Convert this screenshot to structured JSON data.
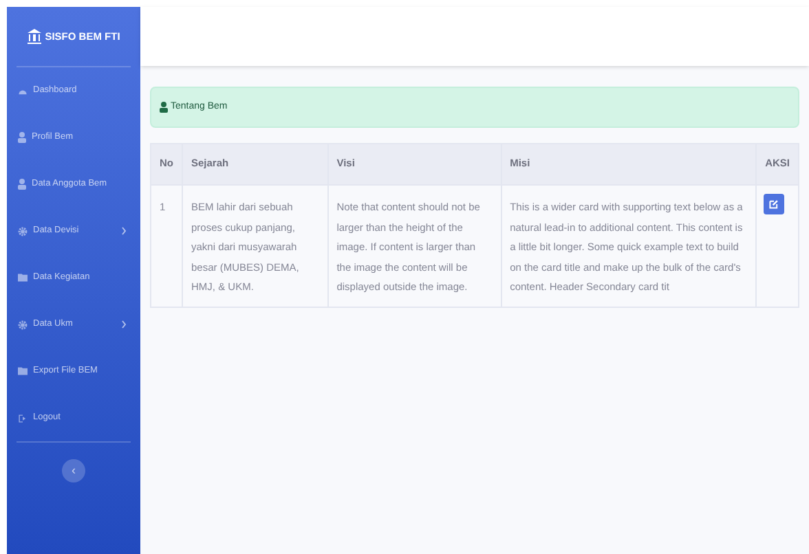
{
  "sidebar": {
    "brand": "SISFO BEM FTI",
    "items": [
      {
        "label": "Dashboard",
        "kind": "gauge",
        "has_children": false
      },
      {
        "label": "Profil Bem",
        "kind": "user",
        "has_children": false
      },
      {
        "label": "Data Anggota Bem",
        "kind": "user",
        "has_children": false
      },
      {
        "label": "Data Devisi",
        "kind": "cog",
        "has_children": true
      },
      {
        "label": "Data Kegiatan",
        "kind": "folder",
        "has_children": false
      },
      {
        "label": "Data Ukm",
        "kind": "cog",
        "has_children": true
      },
      {
        "label": "Export File BEM",
        "kind": "folder",
        "has_children": false
      },
      {
        "label": "Logout",
        "kind": "logout",
        "has_children": false
      }
    ],
    "toggle": "‹"
  },
  "alert": {
    "text": "Tentang Bem"
  },
  "table": {
    "columns": [
      "No",
      "Sejarah",
      "Visi",
      "Misi",
      "AKSI"
    ],
    "rows": [
      {
        "no": "1",
        "sejarah": "BEM lahir dari sebuah proses cukup panjang, yakni dari musyawarah besar (MUBES) DEMA, HMJ, & UKM.",
        "visi": "Note that content should not be larger than the height of the image. If content is larger than the image the content will be displayed outside the image.",
        "misi": "This is a wider card with supporting text below as a natural lead-in to additional content. This content is a little bit longer. Some quick example text to build on the card title and make up the bulk of the card's content. Header Secondary card tit"
      }
    ]
  }
}
